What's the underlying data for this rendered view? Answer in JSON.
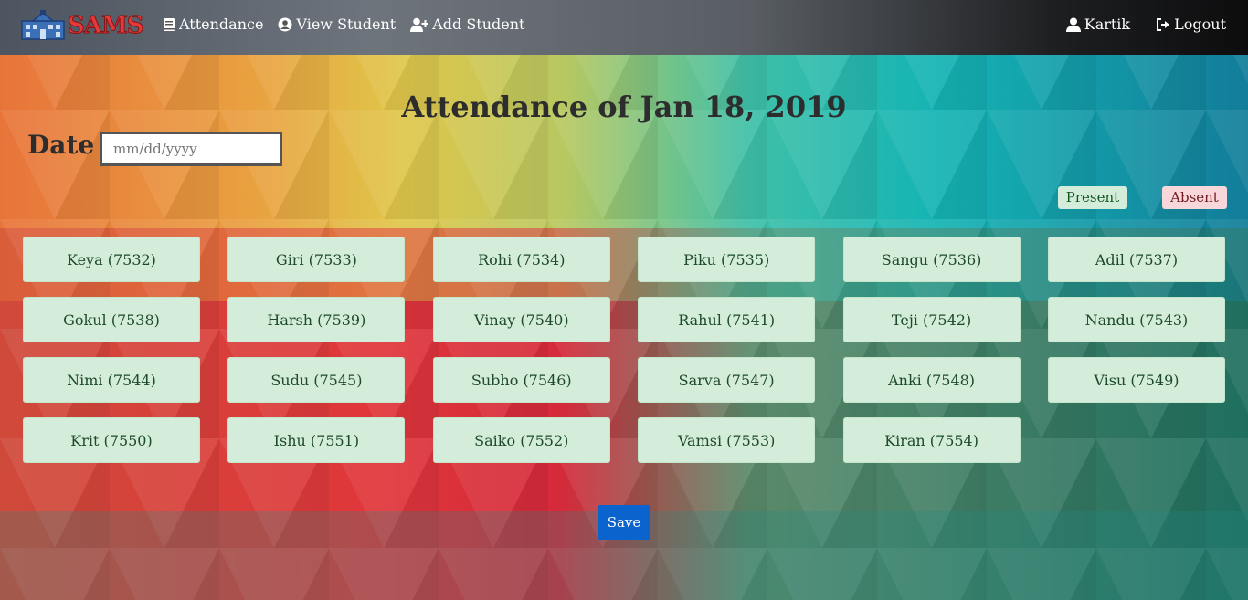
{
  "brand": {
    "logo_text": "SAMS"
  },
  "nav": {
    "left": [
      {
        "label": "Attendance",
        "icon": "book-icon"
      },
      {
        "label": "View Student",
        "icon": "user-circle-icon"
      },
      {
        "label": "Add Student",
        "icon": "user-plus-icon"
      }
    ],
    "right": [
      {
        "label": "Kartik",
        "icon": "user-icon"
      },
      {
        "label": "Logout",
        "icon": "sign-out-icon"
      }
    ]
  },
  "page": {
    "title": "Attendance of Jan 18, 2019",
    "date_label": "Date",
    "date_placeholder": "mm/dd/yyyy"
  },
  "legend": {
    "present": "Present",
    "absent": "Absent"
  },
  "colors": {
    "present": "#d4edda",
    "absent": "#f8d7da",
    "save": "#0b63ce"
  },
  "students": [
    "Keya (7532)",
    "Giri (7533)",
    "Rohi (7534)",
    "Piku (7535)",
    "Sangu (7536)",
    "Adil (7537)",
    "Gokul (7538)",
    "Harsh (7539)",
    "Vinay (7540)",
    "Rahul (7541)",
    "Teji (7542)",
    "Nandu (7543)",
    "Nimi (7544)",
    "Sudu (7545)",
    "Subho (7546)",
    "Sarva (7547)",
    "Anki (7548)",
    "Visu (7549)",
    "Krit (7550)",
    "Ishu (7551)",
    "Saiko (7552)",
    "Vamsi (7553)",
    "Kiran (7554)"
  ],
  "actions": {
    "save_label": "Save"
  }
}
